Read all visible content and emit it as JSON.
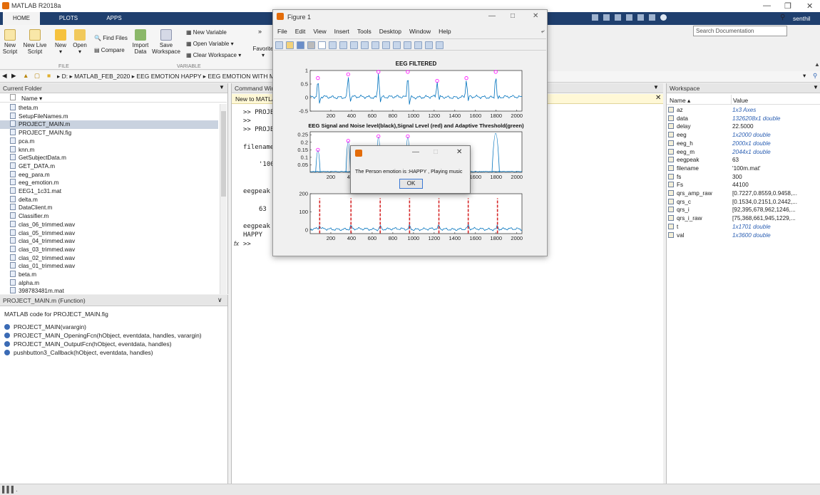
{
  "app": {
    "title": "MATLAB R2018a",
    "user": "senthil"
  },
  "tabs": [
    "HOME",
    "PLOTS",
    "APPS"
  ],
  "search": {
    "placeholder": "Search Documentation"
  },
  "ribbon": {
    "new_script": "New Script",
    "new_live_script": "New Live Script",
    "new": "New",
    "open": "Open",
    "find_files": "Find Files",
    "compare": "Compare",
    "import_data": "Import Data",
    "save_workspace": "Save Workspace",
    "new_variable": "New Variable",
    "open_variable": "Open Variable",
    "clear_workspace": "Clear Workspace",
    "favorites": "Favorite",
    "section_file": "FILE",
    "section_variable": "VARIABLE"
  },
  "address": {
    "drive": "D:",
    "crumbs": [
      "MATLAB_FEB_2020",
      "EEG EMOTION HAPPY",
      "EEG EMOTION WITH MU"
    ]
  },
  "folder": {
    "title": "Current Folder",
    "col_name": "Name",
    "files": [
      "theta.m",
      "SetupFileNames.m",
      "PROJECT_MAIN.m",
      "PROJECT_MAIN.fig",
      "pca.m",
      "knn.m",
      "GetSubjectData.m",
      "GET_DATA.m",
      "eeg_para.m",
      "eeg_emotion.m",
      "EEG1_1c31.mat",
      "delta.m",
      "DataClient.m",
      "Classifier.m",
      "clas_06_trimmed.wav",
      "clas_05_trimmed.wav",
      "clas_04_trimmed.wav",
      "clas_03_trimmed.wav",
      "clas_02_trimmed.wav",
      "clas_01_trimmed.wav",
      "beta.m",
      "alpha.m",
      "398783481m.mat"
    ],
    "selected": "PROJECT_MAIN.m"
  },
  "details": {
    "title": "PROJECT_MAIN.m  (Function)",
    "desc": "MATLAB code for PROJECT_MAIN.fig",
    "functions": [
      "PROJECT_MAIN(varargin)",
      "PROJECT_MAIN_OpeningFcn(hObject, eventdata, handles, varargin)",
      "PROJECT_MAIN_OutputFcn(hObject, eventdata, handles)",
      "pushbutton3_Callback(hObject, eventdata, handles)"
    ]
  },
  "command": {
    "title": "Command Win",
    "banner": "New to MATLA",
    "lines": [
      ">> PROJE",
      ">>",
      ">> PROJE",
      "filename",
      "'100",
      "eegpeak",
      "63",
      "eegpeak",
      "HAPPY"
    ],
    "prompt": ">>",
    "fx": "fx"
  },
  "workspace": {
    "title": "Workspace",
    "col_name": "Name",
    "col_value": "Value",
    "vars": [
      {
        "name": "az",
        "value": "1x3 Axes",
        "link": true
      },
      {
        "name": "data",
        "value": "1326208x1 double",
        "link": true
      },
      {
        "name": "delay",
        "value": "22.5000",
        "link": false
      },
      {
        "name": "eeg",
        "value": "1x2000 double",
        "link": true
      },
      {
        "name": "eeg_h",
        "value": "2000x1 double",
        "link": true
      },
      {
        "name": "eeg_m",
        "value": "2044x1 double",
        "link": true
      },
      {
        "name": "eegpeak",
        "value": "63",
        "link": false
      },
      {
        "name": "filename",
        "value": "'100m.mat'",
        "link": false
      },
      {
        "name": "fs",
        "value": "300",
        "link": false
      },
      {
        "name": "Fs",
        "value": "44100",
        "link": false
      },
      {
        "name": "qrs_amp_raw",
        "value": "[0.7227,0.8559,0.9458,...",
        "link": false
      },
      {
        "name": "qrs_c",
        "value": "[0.1534,0.2151,0.2442,...",
        "link": false
      },
      {
        "name": "qrs_i",
        "value": "[92,395,678,962,1246,...",
        "link": false
      },
      {
        "name": "qrs_i_raw",
        "value": "[75,368,661,945,1229,...",
        "link": false
      },
      {
        "name": "t",
        "value": "1x1701 double",
        "link": true
      },
      {
        "name": "val",
        "value": "1x3600 double",
        "link": true
      }
    ]
  },
  "figure": {
    "title": "Figure 1",
    "menu": [
      "File",
      "Edit",
      "View",
      "Insert",
      "Tools",
      "Desktop",
      "Window",
      "Help"
    ]
  },
  "dialog": {
    "message": "The Person emotion is :HAPPY , Playing music",
    "ok": "OK"
  },
  "chart_data": [
    {
      "type": "line",
      "title": "EEG FILTERED",
      "x_ticks": [
        200,
        400,
        600,
        800,
        1000,
        1200,
        1400,
        1600,
        1800,
        2000
      ],
      "y_ticks": [
        1,
        0.5,
        0,
        -0.5
      ],
      "xlim": [
        0,
        2050
      ],
      "ylim": [
        -0.5,
        1
      ],
      "peaks_x": [
        75,
        368,
        661,
        945,
        1229,
        1512,
        1796
      ],
      "peaks_y": [
        0.72,
        0.86,
        0.95,
        0.95,
        0.62,
        0.72,
        0.95
      ],
      "series_color": "#0072bd",
      "marker_color": "#ff00ff"
    },
    {
      "type": "line",
      "title": "EEG  Signal and Noise level(black),Signal Level (red) and Adaptive Threshold(green)",
      "x_ticks": [
        200,
        400,
        600,
        800,
        1000,
        1200,
        1400,
        1600,
        1800,
        2000
      ],
      "y_ticks": [
        0.25,
        0.2,
        0.15,
        0.1,
        0.05
      ],
      "xlim": [
        0,
        2050
      ],
      "ylim": [
        0,
        0.27
      ],
      "peaks_x": [
        75,
        368,
        661,
        945
      ],
      "peaks_y": [
        0.15,
        0.21,
        0.24,
        0.24
      ],
      "series_color": "#0072bd",
      "marker_color": "#ff00ff"
    },
    {
      "type": "line",
      "title": "",
      "x_ticks": [
        200,
        400,
        600,
        800,
        1000,
        1200,
        1400,
        1600,
        1800,
        2000
      ],
      "y_ticks": [
        200,
        100,
        0
      ],
      "xlim": [
        0,
        2050
      ],
      "ylim": [
        -20,
        200
      ],
      "peaks_x": [
        92,
        395,
        678,
        962,
        1246,
        1530,
        1813
      ],
      "series_color": "#0072bd",
      "marker_color": "#d62728"
    }
  ]
}
